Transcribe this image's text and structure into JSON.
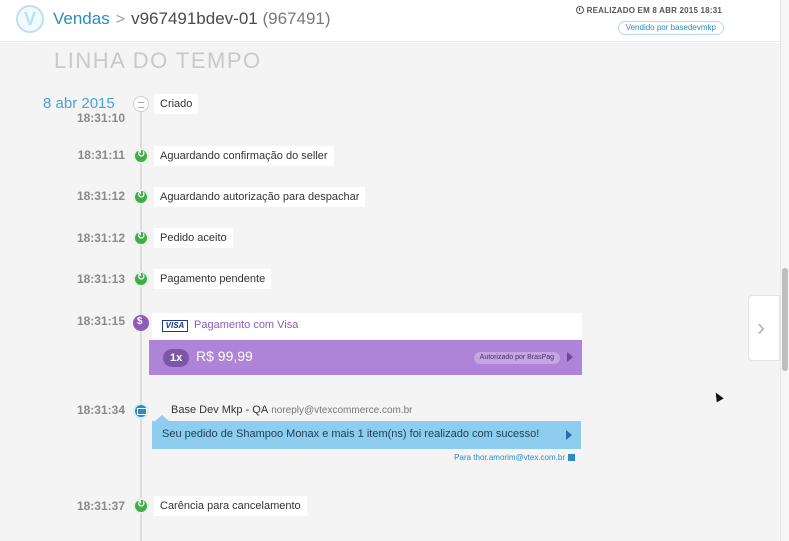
{
  "header": {
    "app_name": "Vendas",
    "separator": ">",
    "order_id": "v967491bdev-01",
    "order_code": "(967491)",
    "realized_text": "REALIZADO EM 8 ABR 2015 18:31",
    "seller_pill": "Vendido por basedevmkp"
  },
  "timeline": {
    "title": "LINHA DO TEMPO",
    "date": "8 abr 2015",
    "events": [
      {
        "time": "18:31:10",
        "label": "Criado",
        "icon": "document-icon"
      },
      {
        "time": "18:31:11",
        "label": "Aguardando confirmação do seller",
        "icon": "refresh-icon"
      },
      {
        "time": "18:31:12",
        "label": "Aguardando autorização para despachar",
        "icon": "refresh-icon"
      },
      {
        "time": "18:31:12",
        "label": "Pedido aceito",
        "icon": "refresh-icon"
      },
      {
        "time": "18:31:13",
        "label": "Pagamento pendente",
        "icon": "refresh-icon"
      },
      {
        "time": "18:31:37",
        "label": "Carência para cancelamento",
        "icon": "refresh-icon"
      }
    ],
    "payment": {
      "time": "18:31:15",
      "card_brand": "VISA",
      "title": "Pagamento com Visa",
      "installments": "1x",
      "amount": "R$ 99,99",
      "status_pill": "Autorizado por BrasPag",
      "icon": "dollar-icon"
    },
    "email": {
      "time": "18:31:34",
      "sender_name": "Base Dev Mkp - QA",
      "sender_address": "noreply@vtexcommerce.com.br",
      "message": "Seu pedido de Shampoo Monax e mais 1 item(ns) foi realizado com sucesso!",
      "recipient": "Para thor.amorim@vtex.com.br",
      "icon": "envelope-icon"
    }
  },
  "pager": {
    "icon": "chevron-right-icon",
    "glyph": "›"
  },
  "colors": {
    "accent_blue": "#2b8cc4",
    "status_green": "#3fae49",
    "payment_purple": "#ad84d8",
    "email_blue": "#8ecdf0"
  }
}
